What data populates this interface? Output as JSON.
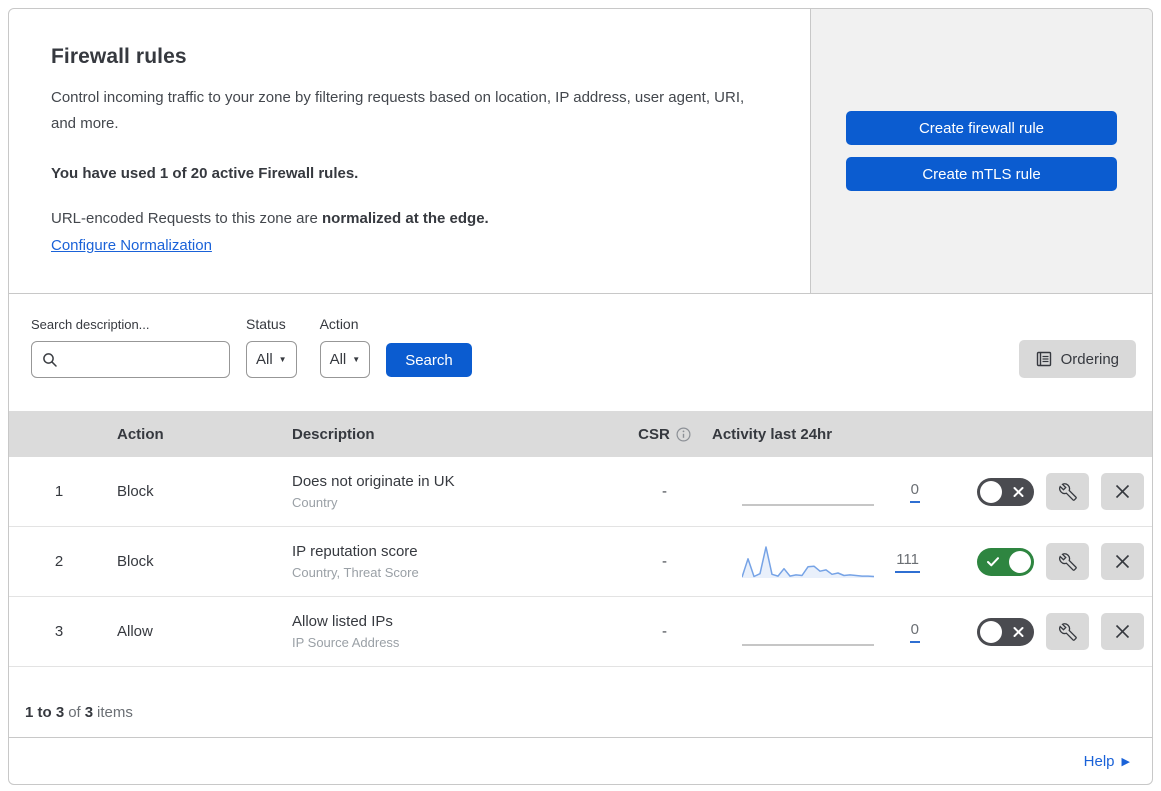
{
  "header": {
    "title": "Firewall rules",
    "description": "Control incoming traffic to your zone by filtering requests based on location, IP address, user agent, URI, and more.",
    "usage": "You have used 1 of 20 active Firewall rules.",
    "normalization_prefix": "URL-encoded Requests to this zone are ",
    "normalization_bold": "normalized at the edge.",
    "normalization_link": "Configure Normalization",
    "create_firewall_button": "Create firewall rule",
    "create_mtls_button": "Create mTLS rule"
  },
  "filters": {
    "search_label": "Search description...",
    "status_label": "Status",
    "status_value": "All",
    "action_label": "Action",
    "action_value": "All",
    "search_button": "Search",
    "ordering_button": "Ordering"
  },
  "table": {
    "header": {
      "action": "Action",
      "description": "Description",
      "csr": "CSR",
      "activity": "Activity last 24hr"
    },
    "rows": [
      {
        "num": "1",
        "action": "Block",
        "description": "Does not originate in UK",
        "criteria": "Country",
        "csr": "-",
        "count": "0",
        "enabled": false,
        "sparkline": null
      },
      {
        "num": "2",
        "action": "Block",
        "description": "IP reputation score",
        "criteria": "Country, Threat Score",
        "csr": "-",
        "count": "111",
        "enabled": true,
        "sparkline": [
          3,
          62,
          5,
          14,
          100,
          12,
          6,
          30,
          6,
          10,
          8,
          36,
          38,
          22,
          26,
          12,
          16,
          8,
          10,
          8,
          6,
          6,
          5
        ]
      },
      {
        "num": "3",
        "action": "Allow",
        "description": "Allow listed IPs",
        "criteria": "IP Source Address",
        "csr": "-",
        "count": "0",
        "enabled": false,
        "sparkline": null
      }
    ]
  },
  "footer": {
    "range": "1 to 3",
    "of": "of",
    "total": "3",
    "items": "items"
  },
  "help": {
    "label": "Help"
  },
  "colors": {
    "accent_blue": "#0b5cd0",
    "link_blue": "#1a62d8",
    "toggle_on_green": "#2e8540",
    "toggle_off_gray": "#4a4b50",
    "table_header_gray": "#dbdbdb",
    "side_panel_gray": "#f1f1f1",
    "sparkline_blue": "#76a3e6"
  }
}
